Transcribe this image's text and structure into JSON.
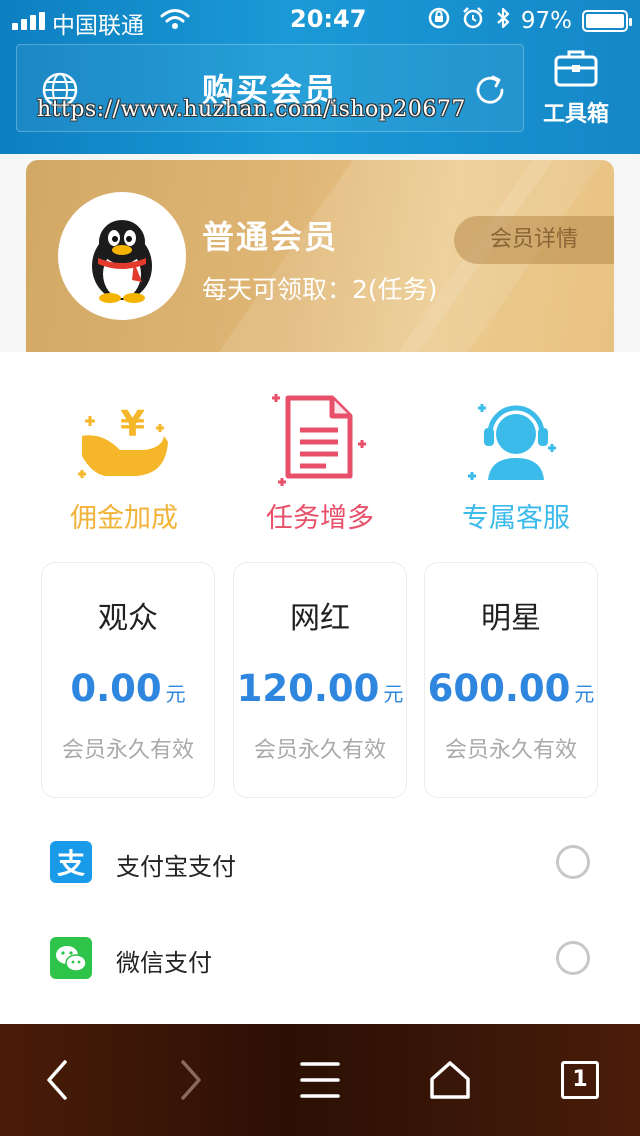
{
  "status": {
    "carrier": "中国联通",
    "time": "20:47",
    "battery": "97%"
  },
  "header": {
    "title": "购买会员",
    "url": "https://www.huzhan.com/ishop20677",
    "toolbox_label": "工具箱"
  },
  "member": {
    "name": "普通会员",
    "quota": "每天可领取：2(任务)",
    "detail_label": "会员详情"
  },
  "benefits": [
    {
      "label": "佣金加成",
      "icon": "yen-hand-icon",
      "color": "#f2b33b"
    },
    {
      "label": "任务增多",
      "icon": "document-icon",
      "color": "#e8506a"
    },
    {
      "label": "专属客服",
      "icon": "headset-service-icon",
      "color": "#3bbbea"
    }
  ],
  "plans": [
    {
      "name": "观众",
      "amount": "0.00",
      "currency": "元",
      "validity": "会员永久有效"
    },
    {
      "name": "网红",
      "amount": "120.00",
      "currency": "元",
      "validity": "会员永久有效"
    },
    {
      "name": "明星",
      "amount": "600.00",
      "currency": "元",
      "validity": "会员永久有效"
    }
  ],
  "payment": [
    {
      "label": "支付宝支付",
      "icon": "alipay-icon",
      "icon_char": "支",
      "color": "#1a9bea"
    },
    {
      "label": "微信支付",
      "icon": "wechat-icon",
      "color": "#2ec44a"
    }
  ],
  "colors": {
    "header_blue": "#1a9ad6",
    "card_gold": "#dfb675",
    "price_blue": "#2e86de"
  },
  "bottom_nav": {
    "tab_count": "1"
  }
}
